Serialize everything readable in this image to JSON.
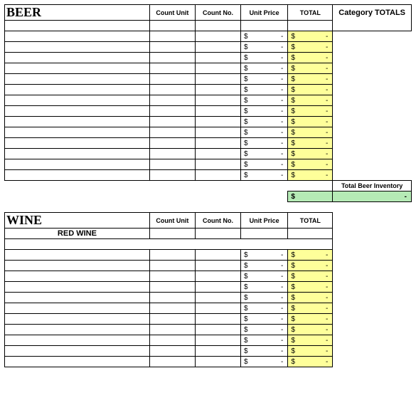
{
  "currency": "$",
  "dash": "-",
  "headers": {
    "count_unit": "Count Unit",
    "count_no": "Count No.",
    "unit_price": "Unit Price",
    "total": "TOTAL",
    "category_totals": "Category TOTALS"
  },
  "beer": {
    "title": "BEER",
    "rows": [
      {},
      {},
      {},
      {},
      {},
      {},
      {},
      {},
      {},
      {},
      {},
      {},
      {},
      {}
    ],
    "inventory_label": "Total Beer Inventory",
    "inventory_total": "-"
  },
  "wine": {
    "title": "WINE",
    "subsection": "RED WINE",
    "rows": [
      {},
      {},
      {},
      {},
      {},
      {},
      {},
      {},
      {},
      {},
      {}
    ]
  }
}
